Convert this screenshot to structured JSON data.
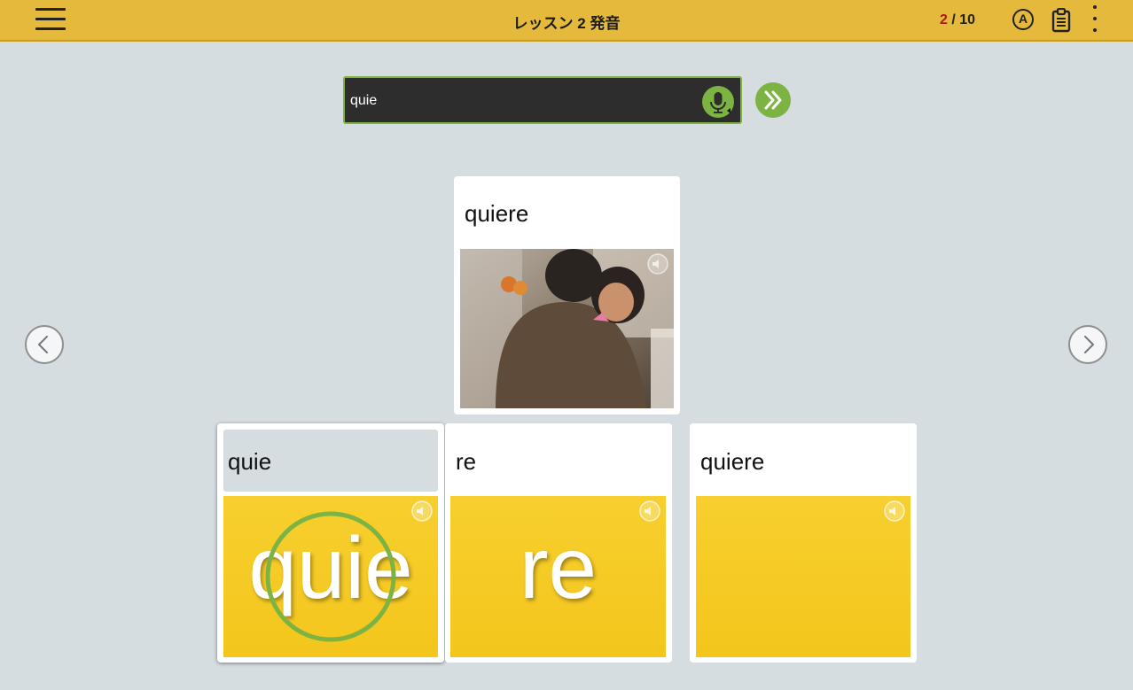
{
  "header": {
    "title": "レッスン 2 発音",
    "progress_current": "2",
    "progress_separator": "/",
    "progress_total": "10",
    "answer_icon_letter": "A",
    "icons": [
      "hamburger-menu-icon",
      "answer-key-icon",
      "clipboard-icon",
      "more-vert-icon"
    ]
  },
  "speech": {
    "recognized_text": "quie",
    "mic_icon": "microphone-icon",
    "next_icon": "double-chevron-right-icon"
  },
  "prompt_card": {
    "word": "quiere",
    "image": "photo-couple-hugging",
    "audio_icon": "speaker-icon"
  },
  "choices": [
    {
      "word": "quie",
      "tile_text": "quie",
      "selected": true,
      "audio_icon": "speaker-icon"
    },
    {
      "word": "re",
      "tile_text": "re",
      "selected": false,
      "audio_icon": "speaker-icon"
    },
    {
      "word": "quiere",
      "tile_text": "",
      "selected": false,
      "audio_icon": "speaker-icon"
    }
  ],
  "nav": {
    "prev_icon": "chevron-left-icon",
    "next_icon": "chevron-right-icon"
  },
  "colors": {
    "header_bg": "#e5b93b",
    "page_bg": "#d6dde1",
    "accent_green": "#7cb342",
    "tile_yellow": "#f5c822",
    "progress_current": "#b0171b"
  }
}
